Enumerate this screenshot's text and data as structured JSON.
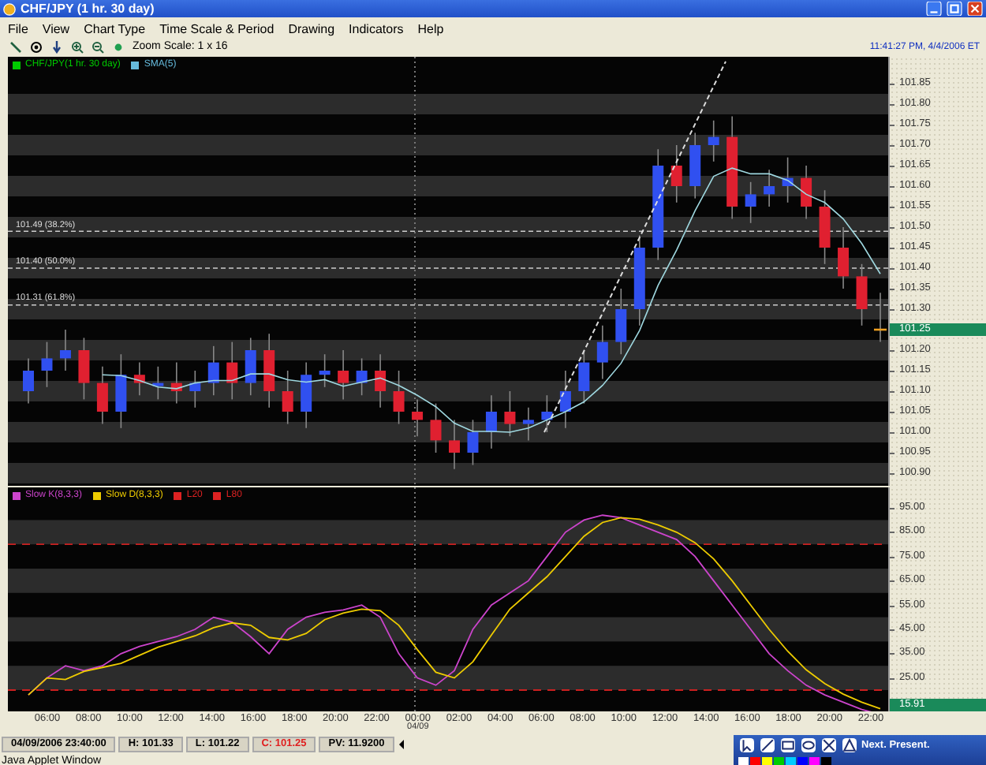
{
  "window": {
    "title": "CHF/JPY (1 hr.  30 day)"
  },
  "menu": [
    "File",
    "View",
    "Chart Type",
    "Time Scale & Period",
    "Drawing",
    "Indicators",
    "Help"
  ],
  "toolbar": {
    "zoom_scale": "Zoom Scale: 1 x 16",
    "clock": "11:41:27 PM, 4/4/2006 ET"
  },
  "price_panel": {
    "legend": [
      {
        "label": "CHF/JPY(1 hr.  30 day)",
        "color": "#00cc00"
      },
      {
        "label": "SMA(5)",
        "color": "#66bbdd"
      }
    ],
    "fib_levels": [
      "101.49 (38.2%)",
      "101.40 (50.0%)",
      "101.31 (61.8%)"
    ],
    "axis_labels": [
      "101.85",
      "101.80",
      "101.75",
      "101.70",
      "101.65",
      "101.60",
      "101.55",
      "101.50",
      "101.45",
      "101.40",
      "101.35",
      "101.30",
      "101.20",
      "101.15",
      "101.10",
      "101.05",
      "101.00",
      "100.95",
      "100.90"
    ],
    "current_price": "101.25"
  },
  "oscillator_panel": {
    "legend": [
      {
        "label": "Slow K(8,3,3)",
        "color": "#cc44cc"
      },
      {
        "label": "Slow D(8,3,3)",
        "color": "#eecc00"
      },
      {
        "label": "L20",
        "color": "#dd2222"
      },
      {
        "label": "L80",
        "color": "#dd2222"
      }
    ],
    "axis_labels": [
      "95.00",
      "85.00",
      "75.00",
      "65.00",
      "55.00",
      "45.00",
      "35.00",
      "25.00"
    ],
    "current_value": "15.91"
  },
  "time_axis": {
    "labels": [
      "06:00",
      "08:00",
      "10:00",
      "12:00",
      "14:00",
      "16:00",
      "18:00",
      "20:00",
      "22:00",
      "00:00",
      "02:00",
      "04:00",
      "06:00",
      "08:00",
      "10:00",
      "12:00",
      "14:00",
      "16:00",
      "18:00",
      "20:00",
      "22:00"
    ],
    "date_marker": "04/09"
  },
  "status_bar": [
    {
      "text": "04/09/2006 23:40:00",
      "kind": "plain"
    },
    {
      "text": "H: 101.33",
      "kind": "plain"
    },
    {
      "text": "L: 101.22",
      "kind": "plain"
    },
    {
      "text": "C: 101.25",
      "kind": "close"
    },
    {
      "text": "PV: 11.9200",
      "kind": "plain"
    }
  ],
  "footer": "Java Applet Window",
  "banner": "Next. Present."
}
